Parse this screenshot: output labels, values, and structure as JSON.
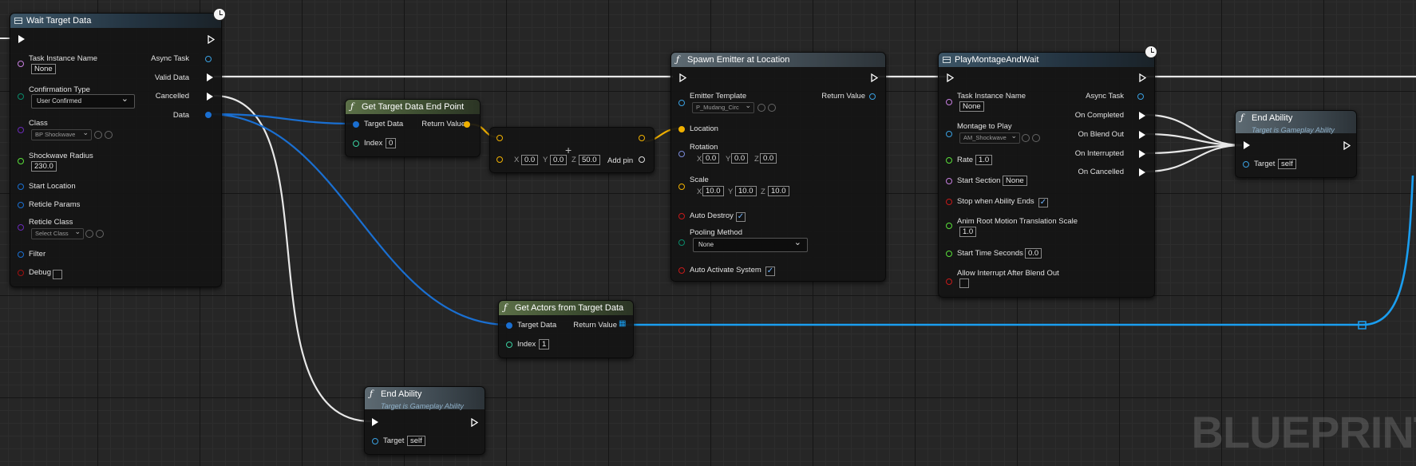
{
  "watermark": "BLUEPRINT",
  "colors": {
    "exec": "#ffffff",
    "struct_blue": "#1a6fd1",
    "vector_yellow": "#f0b000",
    "object_purple": "#9a52d6",
    "name_purple": "#c77fe0",
    "float_green": "#5adf3a",
    "int_teal": "#3ad0a0",
    "bool_red": "#c51a1a",
    "class_purple": "#5a2aa8",
    "enum_teal": "#0a6a5a"
  },
  "wait_target_data": {
    "title": "Wait Target Data",
    "task_instance_name_label": "Task Instance Name",
    "task_instance_name_value": "None",
    "confirmation_type_label": "Confirmation Type",
    "confirmation_type_value": "User Confirmed",
    "class_label": "Class",
    "class_value": "BP Shockwave",
    "shockwave_radius_label": "Shockwave Radius",
    "shockwave_radius_value": "230.0",
    "start_location_label": "Start Location",
    "reticle_params_label": "Reticle Params",
    "reticle_class_label": "Reticle Class",
    "reticle_class_value": "Select Class",
    "filter_label": "Filter",
    "debug_label": "Debug",
    "async_task_label": "Async Task",
    "valid_data_label": "Valid Data",
    "cancelled_label": "Cancelled",
    "data_label": "Data"
  },
  "get_target_data_end_point": {
    "title": "Get Target Data End Point",
    "target_data_label": "Target Data",
    "index_label": "Index",
    "index_value": "0",
    "return_label": "Return Value"
  },
  "make_vector": {
    "x_label": "X",
    "x_value": "0.0",
    "y_label": "Y",
    "y_value": "0.0",
    "z_label": "Z",
    "z_value": "50.0",
    "add_pin_label": "Add pin"
  },
  "spawn_emitter": {
    "title": "Spawn Emitter at Location",
    "emitter_template_label": "Emitter Template",
    "emitter_template_value": "P_Mudang_Circ",
    "return_label": "Return Value",
    "location_label": "Location",
    "rotation_label": "Rotation",
    "rot_x": "0.0",
    "rot_y": "0.0",
    "rot_z": "0.0",
    "scale_label": "Scale",
    "scale_x": "10.0",
    "scale_y": "10.0",
    "scale_z": "10.0",
    "auto_destroy_label": "Auto Destroy",
    "pooling_method_label": "Pooling Method",
    "pooling_method_value": "None",
    "auto_activate_label": "Auto Activate System"
  },
  "play_montage": {
    "title": "PlayMontageAndWait",
    "task_instance_name_label": "Task Instance Name",
    "task_instance_name_value": "None",
    "montage_label": "Montage to Play",
    "montage_value": "AM_Shockwave",
    "rate_label": "Rate",
    "rate_value": "1.0",
    "start_section_label": "Start Section",
    "start_section_value": "None",
    "stop_when_ends_label": "Stop when Ability Ends",
    "anim_root_label": "Anim Root Motion Translation Scale",
    "anim_root_value": "1.0",
    "start_time_label": "Start Time Seconds",
    "start_time_value": "0.0",
    "allow_interrupt_label": "Allow Interrupt After Blend Out",
    "async_task_label": "Async Task",
    "on_completed_label": "On Completed",
    "on_blend_out_label": "On Blend Out",
    "on_interrupted_label": "On Interrupted",
    "on_cancelled_label": "On Cancelled"
  },
  "end_ability_right": {
    "title": "End Ability",
    "subtitle": "Target is Gameplay Ability",
    "target_label": "Target",
    "target_value": "self"
  },
  "get_actors": {
    "title": "Get Actors from Target Data",
    "target_data_label": "Target Data",
    "index_label": "Index",
    "index_value": "1",
    "return_label": "Return Value"
  },
  "end_ability_bottom": {
    "title": "End Ability",
    "subtitle": "Target is Gameplay Ability",
    "target_label": "Target",
    "target_value": "self"
  }
}
